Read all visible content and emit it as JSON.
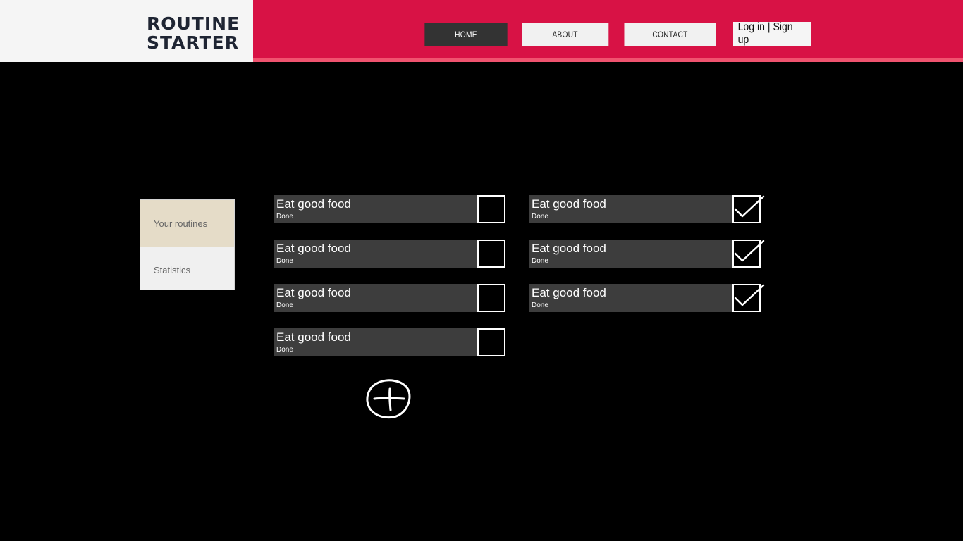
{
  "header": {
    "logo": {
      "line1": "ROUTINE",
      "line2": "STARTER"
    },
    "nav": {
      "home": "HOME",
      "about": "ABOUT",
      "contact": "CONTACT"
    },
    "auth_label": "Log in | Sign up",
    "colors": {
      "accent": "#d81245",
      "stripe": "#f0536f",
      "active_nav": "#333333"
    }
  },
  "sidebar": {
    "items": [
      {
        "label": "Your routines",
        "active": true
      },
      {
        "label": "Statistics",
        "active": false
      }
    ]
  },
  "routines_left": [
    {
      "title": "Eat good food",
      "status": "Done",
      "checked": false
    },
    {
      "title": "Eat good food",
      "status": "Done",
      "checked": false
    },
    {
      "title": "Eat good food",
      "status": "Done",
      "checked": false
    },
    {
      "title": "Eat good food",
      "status": "Done",
      "checked": false
    }
  ],
  "routines_right": [
    {
      "title": "Eat good food",
      "status": "Done",
      "checked": true
    },
    {
      "title": "Eat good food",
      "status": "Done",
      "checked": true
    },
    {
      "title": "Eat good food",
      "status": "Done",
      "checked": true
    }
  ],
  "add_icon": "plus-circle-icon"
}
